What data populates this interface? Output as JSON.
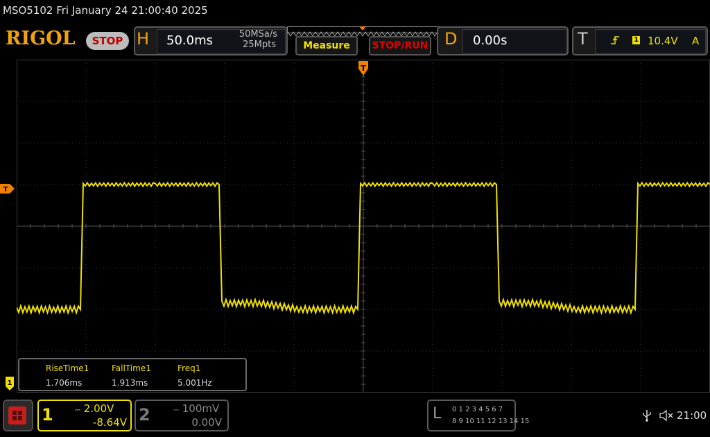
{
  "window": {
    "title": "MSO5102  Fri January 24 21:00:40 2025"
  },
  "header": {
    "logo": "RIGOL",
    "run_state": "STOP",
    "horizontal": {
      "letter": "H",
      "timebase": "50.0ms",
      "sample_rate": "50MSa/s",
      "memory_depth": "25Mpts"
    },
    "measure_label": "Measure",
    "stop_run_label": "STOP/RUN",
    "delay": {
      "letter": "D",
      "value": "0.00s"
    },
    "trigger": {
      "letter": "T",
      "source": "1",
      "level": "10.4V",
      "mode": "A"
    }
  },
  "markers": {
    "trigger_position": "T",
    "trigger_level": "T",
    "channel1": "1"
  },
  "measurements": [
    {
      "label": "RiseTime1",
      "value": "1.706ms"
    },
    {
      "label": "FallTime1",
      "value": "1.913ms"
    },
    {
      "label": "Freq1",
      "value": "5.001Hz"
    }
  ],
  "channels": [
    {
      "number": "1",
      "scale": "2.00V",
      "offset": "-8.64V",
      "coupling_symbol": "DC",
      "color": "#f0e000",
      "active": true
    },
    {
      "number": "2",
      "scale": "100mV",
      "offset": "0.00V",
      "coupling_symbol": "DC",
      "color": "#8a8a8a",
      "active": false
    }
  ],
  "logic_analyzer": {
    "letter": "L",
    "row1": "0 1 2 3  4 5 6 7",
    "row2": "8  9 10 11  12 13 14 15"
  },
  "status": {
    "clock": "21:00",
    "icons": [
      "usb-icon",
      "speaker-muted-icon"
    ]
  },
  "chart_data": {
    "type": "line",
    "series": [
      {
        "color": "#f0e000",
        "x_ms": [
          -250,
          -204,
          -202,
          -150,
          -104,
          -102,
          -75,
          -45,
          -4,
          -2,
          50,
          96,
          98,
          125,
          155,
          196,
          198,
          250
        ],
        "y_div": [
          -2.0,
          -2.0,
          1.0,
          1.0,
          1.0,
          -1.85,
          -1.85,
          -2.0,
          -2.0,
          1.0,
          1.0,
          1.0,
          -1.85,
          -1.85,
          -2.0,
          -2.0,
          1.0,
          1.0
        ]
      }
    ],
    "xlim_ms": [
      -250,
      250
    ],
    "ylim_div": [
      -4,
      4
    ],
    "grid": true
  }
}
